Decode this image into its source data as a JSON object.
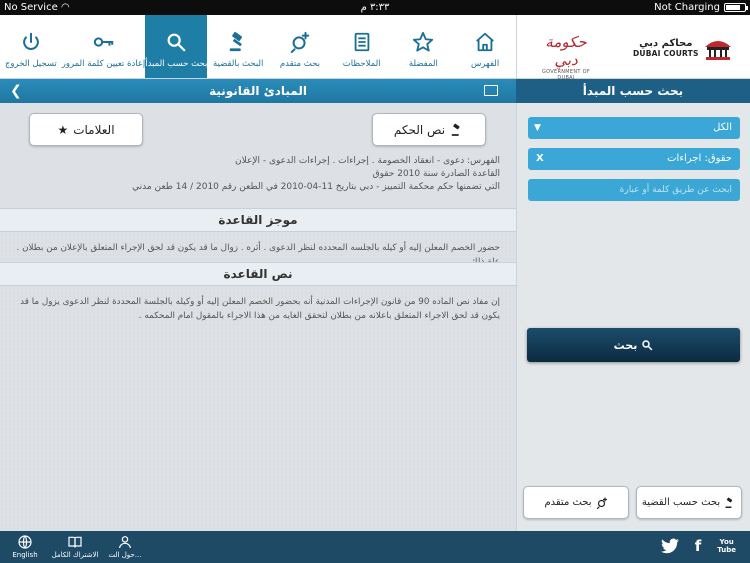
{
  "status_bar": {
    "carrier": "No Service",
    "time": "٣:٣٣ م",
    "battery_status": "Not Charging"
  },
  "top_nav": {
    "items": [
      {
        "label": "تسجيل الخروج",
        "icon": "power-icon"
      },
      {
        "label": "إعادة تعيين كلمة المرور",
        "icon": "key-icon"
      },
      {
        "label": "بحث حسب المبدأ",
        "icon": "search-icon"
      },
      {
        "label": "البحث بالقضية",
        "icon": "gavel-icon"
      },
      {
        "label": "بحث متقدم",
        "icon": "search-plus-icon"
      },
      {
        "label": "الملاحظات",
        "icon": "notes-icon"
      },
      {
        "label": "المفضلة",
        "icon": "star-icon"
      },
      {
        "label": "الفهرس",
        "icon": "home-icon"
      }
    ]
  },
  "logos": {
    "gov_ar": "حكومة دبي",
    "gov_en": "GOVERNMENT OF DUBAI",
    "courts_ar": "محاكم دبي",
    "courts_en": "DUBAI COURTS"
  },
  "main": {
    "title": "المبادئ القانونية",
    "judgment_text_button": "نص الحكم",
    "bookmarks_button": "العلامات",
    "info_lines": [
      "الفهرس: دعوى - انعقاد الخصومة . إجراءات . إجراءات الدعوى - الإعلان",
      "القاعدة الصادرة سنة 2010 حقوق",
      "التي تضمنها حكم محكمة التمييز - دبي بتاريخ 11-04-2010 في الطعن رقم 2010 / 14 طعن مدني"
    ],
    "summary_heading": "موجز القاعدة",
    "summary_text": "حضور الخصم المعلن إليه أو كيله بالجلسه المحدده لنظر الدعوى . أثره . زوال ما قد يكون قد لحق الإجراء المتعلق بالإعلان من بطلان . علة ذلك.",
    "rule_heading": "نص القاعدة",
    "rule_text": "إن مفاد نص الماده 90 من قانون الإجراءات المدنية أنه بحضور الخصم المعلن إليه أو وكيله بالجلسة المحددة لنظر الدعوى يزول ما قد يكون قد لحق الاجراء المتعلق باعلانه من بطلان لتحقق الغايه من هذا الاجراء بالمقول امام المحكمه ."
  },
  "sidebar": {
    "title": "بحث حسب المبدأ",
    "category_select": "الكل",
    "filter_chip": "حقوق: اجراءات",
    "filter_clear": "X",
    "search_placeholder": "ابحث عن طريق كلمة أو عبارة",
    "search_button": "بحث",
    "case_search_button": "بحث حسب القضية",
    "advanced_search_button": "بحث متقدم"
  },
  "bottom_bar": {
    "items": [
      {
        "label": "English",
        "icon": "globe-icon"
      },
      {
        "label": "الاشتراك الكامل",
        "icon": "book-icon"
      },
      {
        "label": "حول الت...",
        "icon": "user-icon"
      }
    ],
    "social": {
      "twitter": "twitter-icon",
      "facebook": "f",
      "youtube_top": "You",
      "youtube_bottom": "Tube"
    }
  },
  "colors": {
    "accent": "#1f7ea6",
    "side_title": "#1d5f85",
    "field_blue": "#3aa7d6",
    "bottom_bar": "#1f4a66"
  }
}
